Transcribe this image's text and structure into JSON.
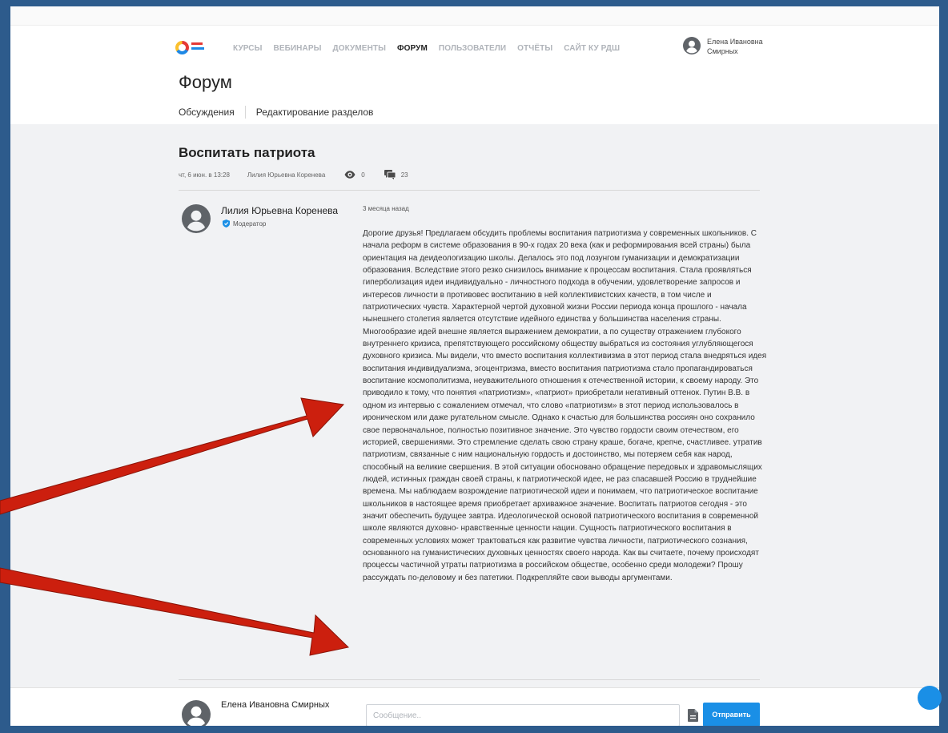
{
  "header": {
    "nav": [
      {
        "label": "КУРСЫ",
        "active": false
      },
      {
        "label": "ВЕБИНАРЫ",
        "active": false
      },
      {
        "label": "ДОКУМЕНТЫ",
        "active": false
      },
      {
        "label": "ФОРУМ",
        "active": true
      },
      {
        "label": "ПОЛЬЗОВАТЕЛИ",
        "active": false
      },
      {
        "label": "ОТЧЁТЫ",
        "active": false
      },
      {
        "label": "САЙТ КУ РДШ",
        "active": false
      }
    ],
    "user_name": "Елена Ивановна Смирных"
  },
  "page": {
    "title": "Форум",
    "subnav": {
      "discussions": "Обсуждения",
      "edit_sections": "Редактирование разделов"
    }
  },
  "thread": {
    "title": "Воспитать патриота",
    "date": "чт, 6 июн. в 13:28",
    "author": "Лилия Юрьевна Коренева",
    "views": "0",
    "comments": "23"
  },
  "post": {
    "author_name": "Лилия Юрьевна Коренева",
    "author_role": "Модератор",
    "time": "3 месяца назад",
    "text": "Дорогие друзья! Предлагаем обсудить проблемы воспитания патриотизма у современных школьников. С начала реформ в системе образования в 90-х годах 20 века (как и реформирования всей страны) была ориентация на деидеологизацию школы. Делалось это под лозунгом гуманизации и демократизации образования. Вследствие этого резко снизилось внимание к процессам воспитания. Стала проявляться гиперболизация идеи индивидуально - личностного подхода в обучении, удовлетворение запросов и интересов личности в противовес воспитанию в ней коллективистских качеств, в том числе и патриотических чувств. Характерной чертой духовной жизни России периода конца прошлого - начала нынешнего столетия является отсутствие идейного единства у большинства населения страны. Многообразие идей внешне является выражением демократии, а по существу отражением глубокого внутреннего кризиса, препятствующего российскому обществу выбраться из состояния углубляющегося духовного кризиса. Мы видели, что вместо воспитания коллективизма в этот период стала внедряться идея воспитания индивидуализма, эгоцентризма, вместо воспитания патриотизма стало пропагандироваться воспитание космополитизма, неуважительного отношения к отечественной истории, к своему народу. Это приводило к тому, что понятия «патриотизм», «патриот» приобретали негативный оттенок. Путин В.В. в одном из интервью с сожалением отмечал, что слово «патриотизм» в этот период использовалось в ироническом или даже ругательном смысле. Однако к счастью для большинства россиян оно сохранило свое первоначальное, полностью позитивное значение. Это чувство гордости своим отечеством, его историей, свершениями. Это стремление сделать свою страну краше, богаче, крепче, счастливее. утратив патриотизм, связанные с ним национальную гордость и достоинство, мы потеряем себя как народ, способный на великие свершения. В этой ситуации обосновано обращение передовых и здравомыслящих людей, истинных граждан своей страны, к патриотической идее, не раз спасавшей Россию в труднейшие времена. Мы наблюдаем возрождение патриотической идеи и понимаем, что патриотическое воспитание школьников в настоящее время приобретает архиважное значение. Воспитать патриотов сегодня - это значит обеспечить будущее завтра. Идеологической основой патриотического воспитания в современной школе являются духовно- нравственные ценности нации. Сущность патриотического воспитания в современных условиях может трактоваться как развитие чувства личности, патриотического сознания, основанного на гуманистических духовных ценностях своего народа. Как вы считаете, почему происходят процессы частичной утраты патриотизма в российском обществе, особенно среди молодежи? Прошу рассуждать по-деловому и без патетики. Подкрепляйте свои выводы аргументами."
  },
  "reply": {
    "user_name": "Елена Ивановна Смирных",
    "placeholder": "Сообщение..",
    "send_label": "Отправить"
  },
  "colors": {
    "frame_border": "#2d5b8c",
    "accent_blue": "#1a8fe6",
    "annotation_arrow": "#cc1f0e"
  }
}
